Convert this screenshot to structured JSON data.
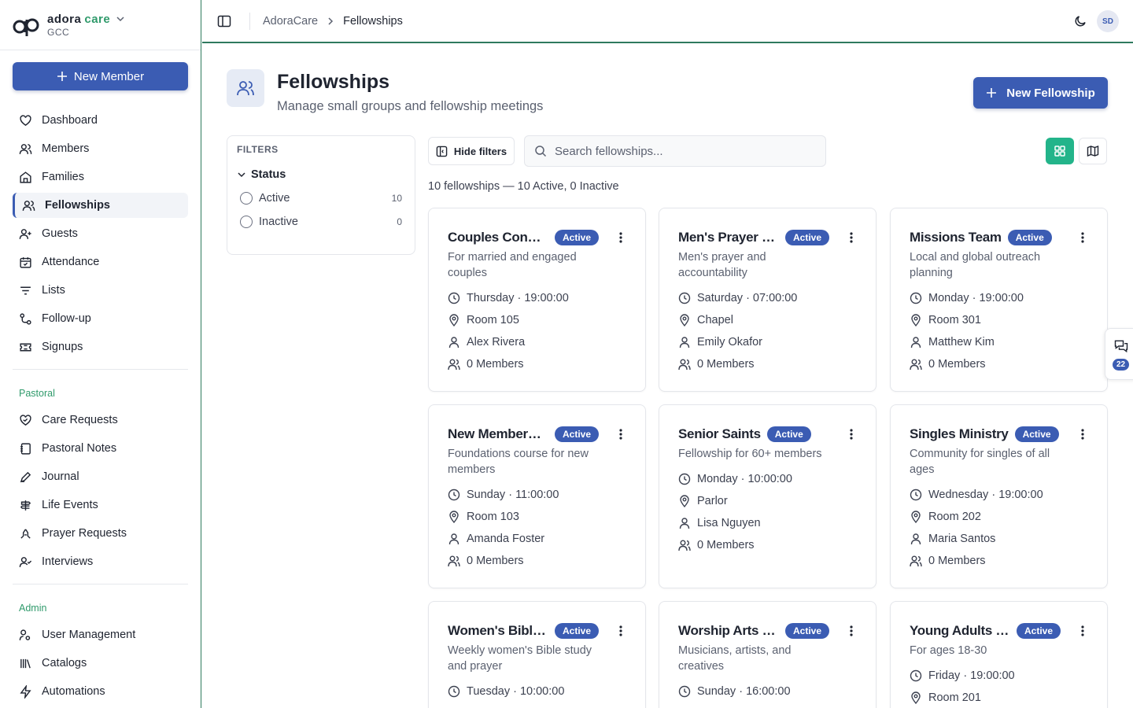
{
  "brand": {
    "name1": "adora",
    "name2": "care",
    "sub": "GCC"
  },
  "sidebar": {
    "new_member": "New Member",
    "main": [
      {
        "label": "Dashboard",
        "icon": "heart-icon"
      },
      {
        "label": "Members",
        "icon": "users-icon"
      },
      {
        "label": "Families",
        "icon": "home-icon"
      },
      {
        "label": "Fellowships",
        "icon": "users-icon"
      },
      {
        "label": "Guests",
        "icon": "user-plus-icon"
      },
      {
        "label": "Attendance",
        "icon": "calendar-check-icon"
      },
      {
        "label": "Lists",
        "icon": "filter-lines-icon"
      },
      {
        "label": "Follow-up",
        "icon": "route-icon"
      },
      {
        "label": "Signups",
        "icon": "ticket-icon"
      }
    ],
    "pastoral_label": "Pastoral",
    "pastoral": [
      {
        "label": "Care Requests",
        "icon": "heart-handshake-icon"
      },
      {
        "label": "Pastoral Notes",
        "icon": "notebook-icon"
      },
      {
        "label": "Journal",
        "icon": "pen-icon"
      },
      {
        "label": "Life Events",
        "icon": "signpost-icon"
      },
      {
        "label": "Prayer Requests",
        "icon": "hands-icon"
      },
      {
        "label": "Interviews",
        "icon": "user-check-icon"
      }
    ],
    "admin_label": "Admin",
    "admin": [
      {
        "label": "User Management",
        "icon": "user-key-icon"
      },
      {
        "label": "Catalogs",
        "icon": "library-icon"
      },
      {
        "label": "Automations",
        "icon": "zap-icon"
      }
    ]
  },
  "topbar": {
    "crumb_root": "AdoraCare",
    "crumb_current": "Fellowships",
    "avatar": "SD"
  },
  "header": {
    "title": "Fellowships",
    "subtitle": "Manage small groups and fellowship meetings",
    "new_button": "New Fellowship"
  },
  "filters": {
    "heading": "FILTERS",
    "group": "Status",
    "options": [
      {
        "label": "Active",
        "count": "10"
      },
      {
        "label": "Inactive",
        "count": "0"
      }
    ]
  },
  "toolbar": {
    "hide_filters": "Hide filters",
    "search_placeholder": "Search fellowships..."
  },
  "summary": "10 fellowships — 10 Active, 0 Inactive",
  "chat": {
    "count": "22"
  },
  "cards": [
    {
      "title": "Couples Connect",
      "status": "Active",
      "desc": "For married and engaged couples",
      "schedule": "Thursday · 19:00:00",
      "location": "Room 105",
      "leader": "Alex Rivera",
      "members": "0 Members"
    },
    {
      "title": "Men's Prayer Group",
      "status": "Active",
      "desc": "Men's prayer and accountability",
      "schedule": "Saturday · 07:00:00",
      "location": "Chapel",
      "leader": "Emily Okafor",
      "members": "0 Members"
    },
    {
      "title": "Missions Team",
      "status": "Active",
      "desc": "Local and global outreach planning",
      "schedule": "Monday · 19:00:00",
      "location": "Room 301",
      "leader": "Matthew Kim",
      "members": "0 Members"
    },
    {
      "title": "New Members Class",
      "status": "Active",
      "desc": "Foundations course for new members",
      "schedule": "Sunday · 11:00:00",
      "location": "Room 103",
      "leader": "Amanda Foster",
      "members": "0 Members"
    },
    {
      "title": "Senior Saints",
      "status": "Active",
      "desc": "Fellowship for 60+ members",
      "schedule": "Monday · 10:00:00",
      "location": "Parlor",
      "leader": "Lisa Nguyen",
      "members": "0 Members"
    },
    {
      "title": "Singles Ministry",
      "status": "Active",
      "desc": "Community for singles of all ages",
      "schedule": "Wednesday · 19:00:00",
      "location": "Room 202",
      "leader": "Maria Santos",
      "members": "0 Members"
    },
    {
      "title": "Women's Bible Study",
      "status": "Active",
      "desc": "Weekly women's Bible study and prayer",
      "schedule": "Tuesday · 10:00:00",
      "location": "",
      "leader": "",
      "members": ""
    },
    {
      "title": "Worship Arts Collective",
      "status": "Active",
      "desc": "Musicians, artists, and creatives",
      "schedule": "Sunday · 16:00:00",
      "location": "",
      "leader": "",
      "members": ""
    },
    {
      "title": "Young Adults Fellowship",
      "status": "Active",
      "desc": "For ages 18-30",
      "schedule": "Friday · 19:00:00",
      "location": "Room 201",
      "leader": "",
      "members": ""
    }
  ]
}
